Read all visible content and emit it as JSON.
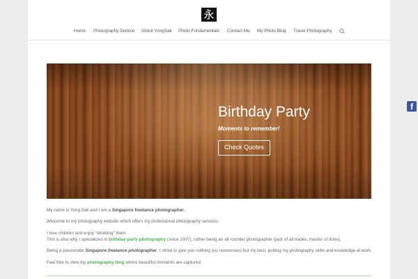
{
  "header": {
    "logo_glyph": "永",
    "nav": [
      {
        "label": "Home"
      },
      {
        "label": "Photography Service"
      },
      {
        "label": "About YongSak"
      },
      {
        "label": "Photo Fundamentals"
      },
      {
        "label": "Contact Me"
      },
      {
        "label": "My Photo Blog"
      },
      {
        "label": "Travel Photography"
      }
    ],
    "search_icon": "search-icon"
  },
  "hero": {
    "title": "Birthday Party",
    "subtitle": "Moments to remember!",
    "button_label": "Check Quotes"
  },
  "social": {
    "facebook_label": "f"
  },
  "content": {
    "p1_pre": "My name is Yong Sak and I am a ",
    "p1_bold": "Singapore freelance photographer.",
    "p2": "Welcome to my photography website which offers my professional photography services.",
    "p3": "I love children and enjoy “shooting” them.",
    "p4_pre": "This is also why I specializes in ",
    "p4_link": "birthday party photography",
    "p4_post": " (since 2007), rather being an all rounder photographer (jack of all trades, master of done).",
    "p5_pre": "Being a passionate ",
    "p5_bold": "Singapore freelance photographer",
    "p5_post": ", I strive to give you nothing (no nonsenses) but my best, putting my photography skills and knowledge at work.",
    "p6_pre": "Feel free to view  my ",
    "p6_link": "photography blog",
    "p6_post": " where beautiful moments are captured."
  },
  "colors": {
    "accent": "#4caf50",
    "facebook": "#3b5998"
  }
}
